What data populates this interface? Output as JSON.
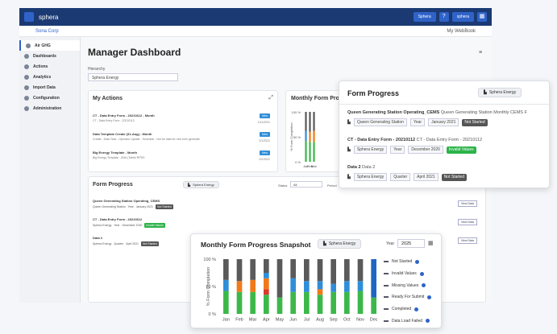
{
  "topbar": {
    "brand": "sphera",
    "button1": "Sphera",
    "button2": "sphera"
  },
  "subbar": {
    "app_name": "Sona Corp",
    "right_link": "My WebBook"
  },
  "sidebar": {
    "items": [
      {
        "label": "Air GHG",
        "active": true
      },
      {
        "label": "Dashboards"
      },
      {
        "label": "Actions"
      },
      {
        "label": "Analytics"
      },
      {
        "label": "Import Data"
      },
      {
        "label": "Configuration"
      },
      {
        "label": "Administration"
      }
    ]
  },
  "page": {
    "title": "Manager Dashboard",
    "hierarchy_label": "Hierarchy",
    "hierarchy_value": "Sphera Energy"
  },
  "my_actions": {
    "title": "My Actions",
    "rows": [
      {
        "title": "CT - Data Entry Form - 20210112 - Month",
        "sub": "CT - Data Entry Form - 20210112",
        "badge": "New",
        "date": "1/11/2021"
      },
      {
        "title": "Data Template Create (31-Aug) - Month",
        "sub": "Create - Data Tank - Operator Update - Schedule - Not for data for new form generate",
        "badge": "New",
        "date": "2/1/2021"
      },
      {
        "title": "Big Energy Template - Month",
        "sub": "Big Energy Template - ANA (Table) RPDS",
        "badge": "New",
        "date": "2/2/2021"
      }
    ]
  },
  "form_progress_bg": {
    "title": "Form Progress",
    "filter": "Sphera Energy",
    "status_label": "Status",
    "status_value": "All",
    "period_label": "Period",
    "rows": [
      {
        "title": "Queen Generating Station Operating_CEMS",
        "sub1": "Queen Generating Station",
        "sub2": "Year",
        "sub3": "January 2021",
        "tag": "Not Started",
        "tag_type": "ns"
      },
      {
        "title": "CT - Data Entry Form - 20210112",
        "sub1": "Sphera Energy",
        "sub2": "Year",
        "sub3": "December 2020",
        "tag": "Invalid Values",
        "tag_type": "iv"
      },
      {
        "title": "Data 2",
        "sub1": "Sphera Energy",
        "sub2": "Quarter",
        "sub3": "April 2021",
        "tag": "Not Started",
        "tag_type": "ns"
      }
    ],
    "view_button": "View Data"
  },
  "form_progress_overlay": {
    "title": "Form Progress",
    "filter": "Sphera Energy",
    "rows": [
      {
        "title": "Queen Generating Station Operating_CEMS",
        "title_extra": "Queen Generating Station Monthly CEMS F",
        "sub1": "Queen Generating Station",
        "sub2": "Year",
        "sub3": "January 2021",
        "tag": "Not Started",
        "tag_type": "ns"
      },
      {
        "title": "CT - Data Entry Form - 20210112",
        "title_extra": "CT - Data Entry Form - 20210112",
        "sub1": "Sphera Energy",
        "sub2": "Year",
        "sub3": "December 2020",
        "tag": "Invalid Values",
        "tag_type": "iv"
      },
      {
        "title": "Data 2",
        "title_extra": "Data 2",
        "sub1": "Sphera Energy",
        "sub2": "Quarter",
        "sub3": "April 2021",
        "tag": "Not Started",
        "tag_type": "ns"
      }
    ]
  },
  "bg_chart": {
    "title": "Monthly Form Progress"
  },
  "snapshot": {
    "title": "Monthly Form Progress Snapshot",
    "filter": "Sphera Energy",
    "year_label": "Year",
    "year_value": "2025"
  },
  "colors": {
    "not_started": "#5a5a5a",
    "invalid": "#2f8ed9",
    "missing": "#f07a1a",
    "ready": "#d93a2a",
    "completed": "#3cb84a",
    "locked": "#1f66c4",
    "accent": "#2f63c8"
  },
  "chart_data": {
    "type": "bar",
    "title": "Monthly Form Progress Snapshot",
    "ylabel": "% Form Completion",
    "ylim": [
      0,
      100
    ],
    "yticks": [
      "100 %",
      "50 %",
      "0 %"
    ],
    "categories": [
      "Jan",
      "Feb",
      "Mar",
      "Apr",
      "May",
      "Jun",
      "Jul",
      "Aug",
      "Sep",
      "Oct",
      "Nov",
      "Dec"
    ],
    "series": [
      {
        "name": "Completed",
        "key": "completed",
        "values": [
          42,
          40,
          40,
          35,
          30,
          40,
          40,
          35,
          40,
          40,
          42,
          30
        ]
      },
      {
        "name": "Ready For Submit",
        "key": "ready",
        "values": [
          0,
          0,
          0,
          10,
          0,
          0,
          0,
          0,
          0,
          0,
          0,
          0
        ]
      },
      {
        "name": "Missing Values",
        "key": "missing",
        "values": [
          0,
          20,
          22,
          20,
          0,
          0,
          0,
          10,
          0,
          0,
          0,
          0
        ]
      },
      {
        "name": "Invalid Values",
        "key": "invalid",
        "values": [
          20,
          0,
          0,
          10,
          0,
          25,
          20,
          15,
          15,
          20,
          18,
          0
        ]
      },
      {
        "name": "Data Load Failed",
        "key": "locked",
        "values": [
          0,
          0,
          0,
          0,
          0,
          0,
          0,
          0,
          0,
          0,
          0,
          70
        ]
      },
      {
        "name": "Not Started",
        "key": "not_started",
        "values": [
          38,
          40,
          38,
          25,
          70,
          35,
          40,
          40,
          45,
          40,
          40,
          0
        ]
      }
    ],
    "legend": [
      "Not Started",
      "Invalid Values",
      "Missing Values",
      "Ready For Submit",
      "Completed",
      "Data Load Failed"
    ],
    "legend_position": "right"
  }
}
